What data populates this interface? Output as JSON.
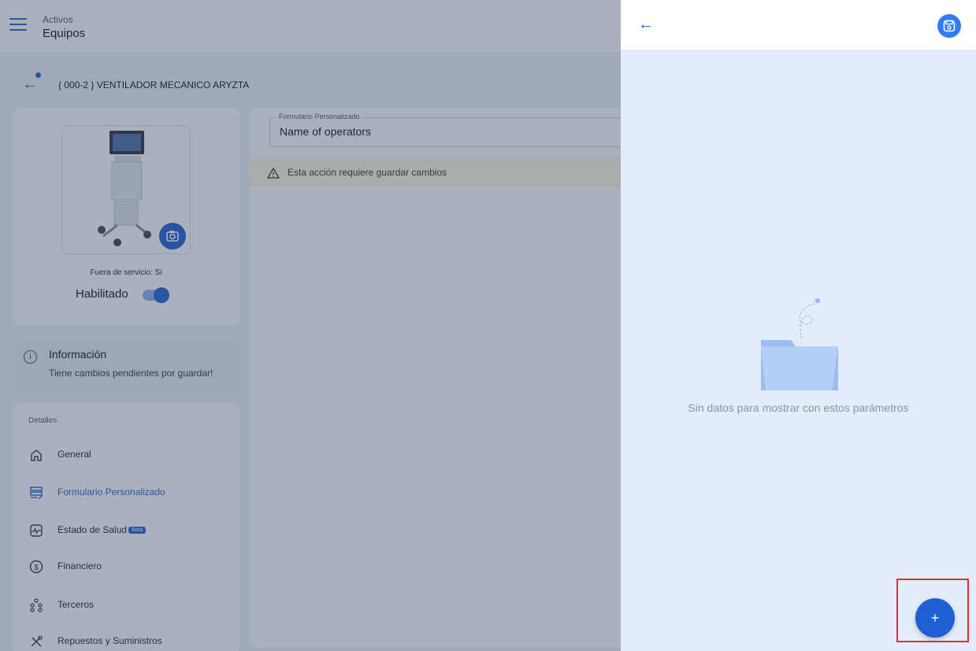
{
  "topbar": {
    "section": "Activos",
    "page": "Equipos"
  },
  "asset": {
    "title": "{ 000-2 } VENTILADOR MECANICO ARYZTA"
  },
  "photo_card": {
    "out_of_service": "Fuera de servicio: Si",
    "enabled_label": "Habilitado",
    "enabled": true
  },
  "info": {
    "title": "Información",
    "message": "Tiene cambios pendientes por guardar!"
  },
  "details": {
    "header": "Detalles",
    "items": [
      {
        "label": "General",
        "icon": "home-icon",
        "active": false
      },
      {
        "label": "Formulario Personalizado",
        "icon": "form-icon",
        "active": true
      },
      {
        "label": "Estado de Salud",
        "icon": "health-icon",
        "active": false,
        "badge": "Beta"
      },
      {
        "label": "Financiero",
        "icon": "dollar-icon",
        "active": false
      },
      {
        "label": "Terceros",
        "icon": "people-icon",
        "active": false
      },
      {
        "label": "Repuestos y Suministros",
        "icon": "tools-icon",
        "active": false
      }
    ]
  },
  "form": {
    "field_label": "Formulario Personalizado",
    "field_value": "Name of operators",
    "warning": "Esta acción requiere guardar cambios"
  },
  "drawer": {
    "empty_message": "Sin datos para mostrar con estos parámetros",
    "fab_label": "+"
  },
  "colors": {
    "primary": "#1f5fd6",
    "drawer_bg": "#e3ecfa",
    "highlight": "#e52d2d",
    "warning_bg": "#fbf6e2"
  }
}
